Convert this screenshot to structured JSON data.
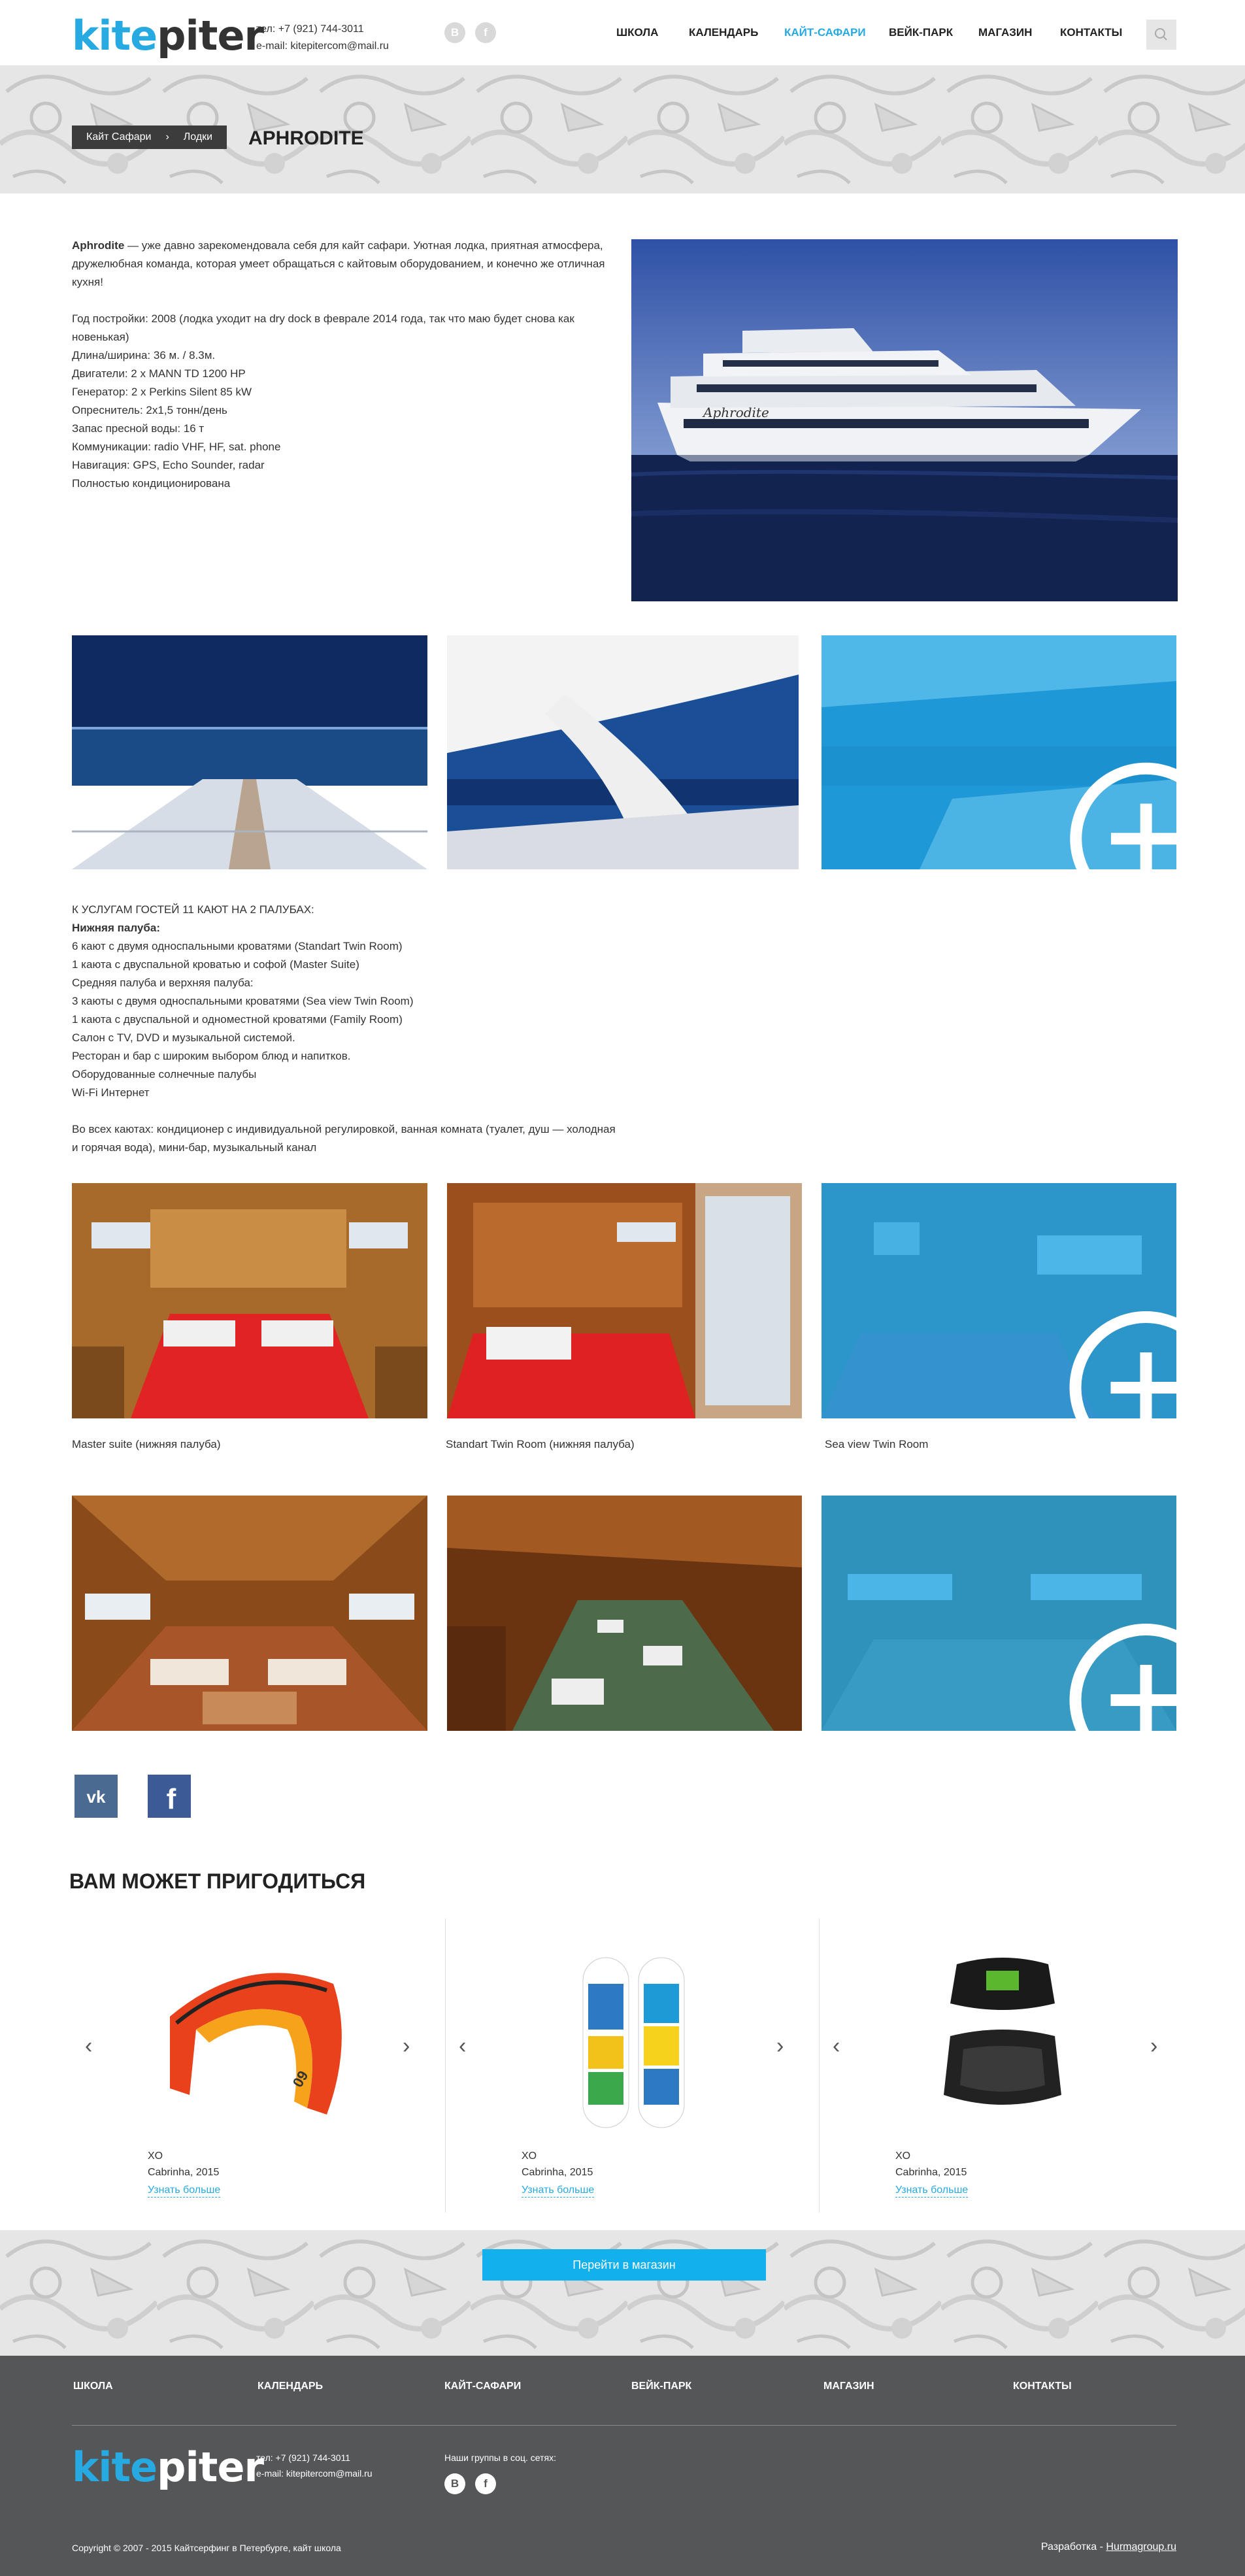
{
  "header": {
    "logo": {
      "part1": "kite",
      "part2": "piter"
    },
    "phone": "тел: +7 (921) 744-3011",
    "email": "e-mail: kitepitercom@mail.ru",
    "social": {
      "vk_icon": "vk-icon",
      "fb_icon": "facebook-icon",
      "vk_glyph": "B",
      "fb_glyph": "f"
    },
    "nav": [
      {
        "label": "ШКОЛА",
        "active": false
      },
      {
        "label": "КАЛЕНДАРЬ",
        "active": false
      },
      {
        "label": "КАЙТ-САФАРИ",
        "active": true
      },
      {
        "label": "ВЕЙК-ПАРК",
        "active": false
      },
      {
        "label": "МАГАЗИН",
        "active": false
      },
      {
        "label": "КОНТАКТЫ",
        "active": false
      }
    ],
    "search_icon": "search-icon"
  },
  "breadcrumb": {
    "items": [
      "Кайт Сафари",
      "Лодки"
    ],
    "separator": "›"
  },
  "page_title": "APHRODITE",
  "intro": {
    "name": "Aphrodite",
    "lead": " — уже давно зарекомендовала себя для кайт сафари. Уютная лодка, приятная атмосфера, дружелюбная команда, которая умеет обращаться с кайтовым оборудованием, и конечно же отличная кухня!",
    "specs": [
      "Год постройки: 2008 (лодка уходит на dry dock в феврале 2014 года, так что маю будет снова как новенькая)",
      "Длина/ширина: 36 м. / 8.3м.",
      "Двигатели: 2 x MANN TD 1200 HP",
      "Генератор: 2 x Perkins Silent 85 kW",
      "Опреснитель: 2x1,5 тонн/день",
      "Запас пресной воды: 16 т",
      "Коммуникации: radio VHF, HF, sat. phone",
      "Навигация: GPS, Echo Sounder, radar",
      "Полностью кондиционирована"
    ]
  },
  "hero_image_label": "Aphrodite",
  "services": {
    "heading": "К УСЛУГАМ ГОСТЕЙ 11 КАЮТ НА 2 ПАЛУБАХ:",
    "lower_deck": "Нижняя палуба:",
    "lines": [
      "6 кают с двумя односпальными кроватями (Standart Twin Room)",
      "1 каюта с двуспальной кроватью и софой (Master Suite)",
      "Средняя палуба и верхняя палуба:",
      "3 каюты с двумя односпальными кроватями (Sea view Twin Room)",
      "1 каюта с двуспальной и одноместной кроватями (Family Room)",
      "Салон с TV, DVD и музыкальной системой.",
      "Ресторан и бар с широким выбором блюд и напитков.",
      "Оборудованные солнечные палубы",
      "Wi-Fi Интернет"
    ],
    "footer": "Во всех каютах: кондиционер с индивидуальной регулировкой, ванная комната (туалет, душ — холодная и горячая вода), мини-бар, музыкальный канал"
  },
  "room_captions": [
    "Master suite (нижняя палуба)",
    "Standart Twin Room (нижняя палуба)",
    "Sea view Twin Room"
  ],
  "share": {
    "vk_icon": "vk-icon",
    "fb_icon": "facebook-icon",
    "vk_glyph": "vk",
    "fb_glyph": "f"
  },
  "related": {
    "title": "ВАМ МОЖЕТ ПРИГОДИТЬСЯ",
    "prev_glyph": "‹",
    "next_glyph": "›",
    "products": [
      {
        "name": "XO",
        "brand": "Cabrinha, 2015",
        "more": "Узнать больше",
        "image": "kite"
      },
      {
        "name": "XO",
        "brand": "Cabrinha, 2015",
        "more": "Узнать больше",
        "image": "wakeboards"
      },
      {
        "name": "XO",
        "brand": "Cabrinha, 2015",
        "more": "Узнать больше",
        "image": "harness"
      }
    ]
  },
  "shop_button": "Перейти в магазин",
  "footer": {
    "nav": [
      "ШКОЛА",
      "КАЛЕНДАРЬ",
      "КАЙТ-САФАРИ",
      "ВЕЙК-ПАРК",
      "МАГАЗИН",
      "КОНТАКТЫ"
    ],
    "logo": {
      "part1": "kite",
      "part2": "piter"
    },
    "phone": "тел: +7 (921) 744-3011",
    "email": "e-mail: kitepitercom@mail.ru",
    "groups_label": "Наши группы в соц. сетях:",
    "vk_glyph": "B",
    "fb_glyph": "f",
    "copyright": "Copyright © 2007 - 2015 Кайтсерфинг в Петербурге, кайт школа",
    "dev_label": "Разработка - ",
    "dev_link": "Hurmagroup.ru"
  },
  "colors": {
    "accent": "#27a9e1",
    "button": "#12b0ec",
    "footer": "#555658",
    "overlay": "#1ca6e6"
  }
}
